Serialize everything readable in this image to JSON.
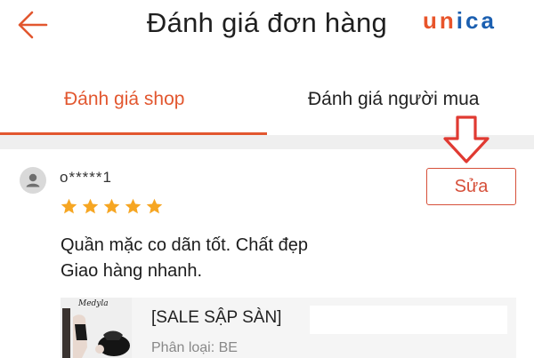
{
  "header": {
    "title": "Đánh giá đơn hàng",
    "back_icon": "arrow-left-icon",
    "logo": {
      "part1": "un",
      "part2": "ica",
      "color1": "#e8542a",
      "color2": "#1b5fb0"
    }
  },
  "tabs": [
    {
      "label": "Đánh giá shop",
      "active": true
    },
    {
      "label": "Đánh giá người mua",
      "active": false
    }
  ],
  "accent_color": "#e2572f",
  "review": {
    "user": "o*****1",
    "rating": 5,
    "lines": [
      "Quần mặc co dãn tốt. Chất đẹp",
      "Giao hàng nhanh."
    ],
    "edit_label": "Sửa"
  },
  "product": {
    "brand": "Medyla",
    "name": "[SALE SẬP SÀN]",
    "variant": "Phân loại: BE"
  }
}
